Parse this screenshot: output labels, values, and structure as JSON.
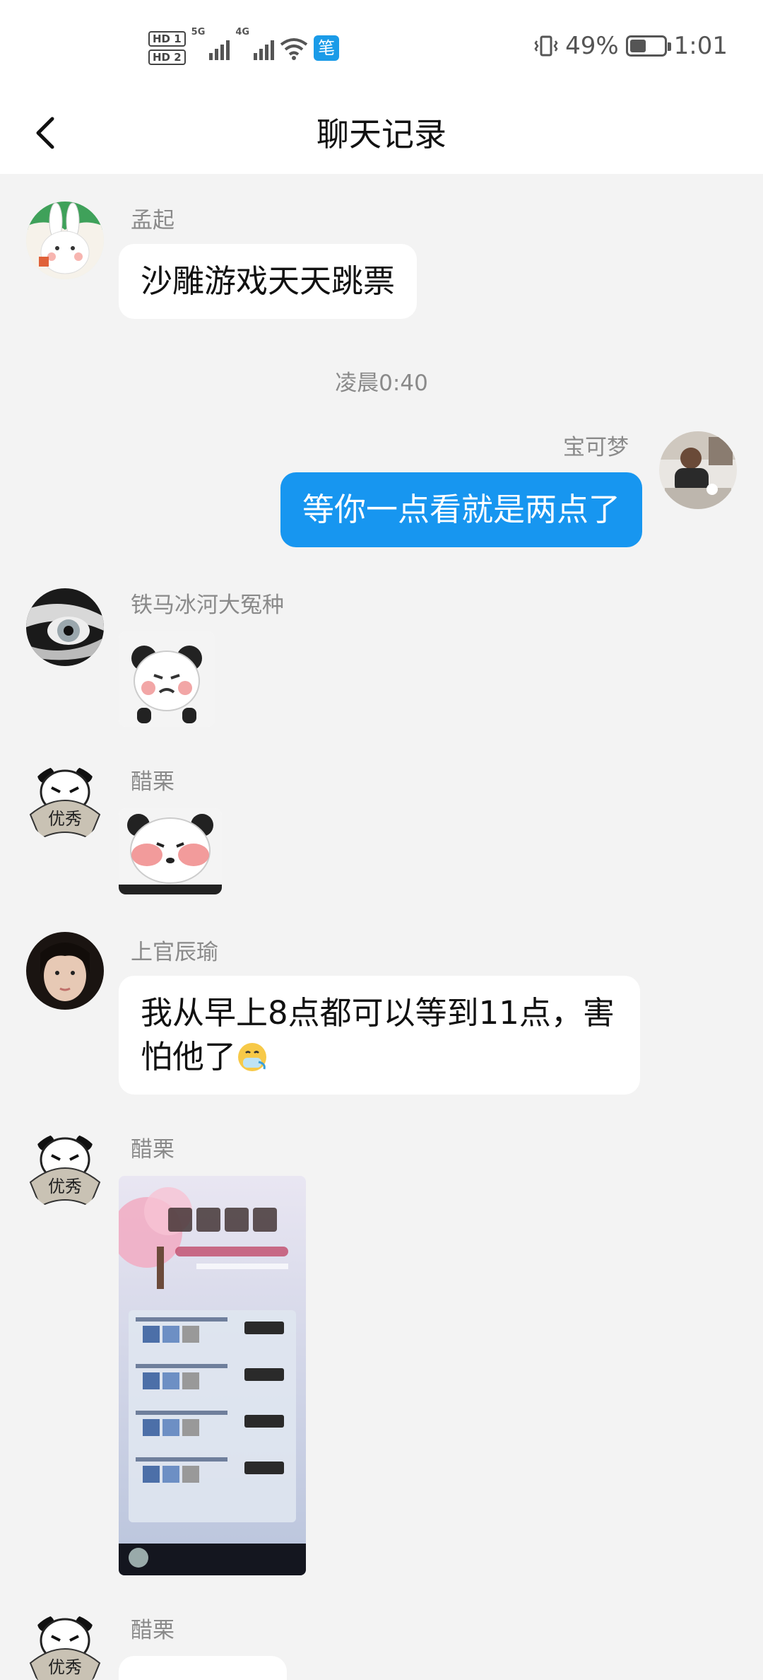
{
  "status_bar": {
    "hd1": "HD 1",
    "hd2": "HD 2",
    "net1": "5G",
    "net2": "4G",
    "app_icon_glyph": "笔",
    "battery_percent": "49%",
    "battery_level": 0.49,
    "time": "1:01"
  },
  "header": {
    "title": "聊天记录",
    "back_icon": "chevron-left-icon"
  },
  "messages": [
    {
      "sender": "孟起",
      "type": "text",
      "text": "沙雕游戏天天跳票"
    },
    {
      "timestamp": "凌晨0:40"
    },
    {
      "sender": "宝可梦",
      "type": "text",
      "text": "等你一点看就是两点了",
      "self": true
    },
    {
      "sender": "铁马冰河大冤种",
      "type": "sticker",
      "sticker": "panda-meme-sticker"
    },
    {
      "sender": "醋栗",
      "type": "sticker",
      "sticker": "blushing-panda-sticker"
    },
    {
      "sender": "上官辰瑜",
      "type": "text",
      "text": "我从早上8点都可以等到11点，害",
      "text_line2": "怕他了",
      "emoji": "sneezing-face-emoji"
    },
    {
      "sender": "醋栗",
      "type": "image",
      "image": "game-event-screenshot"
    },
    {
      "sender": "醋栗",
      "type": "text",
      "text": ""
    }
  ],
  "colors": {
    "background": "#f3f3f3",
    "self_bubble": "#1796f0",
    "other_bubble": "#ffffff",
    "name_text": "#8a8a8a"
  }
}
